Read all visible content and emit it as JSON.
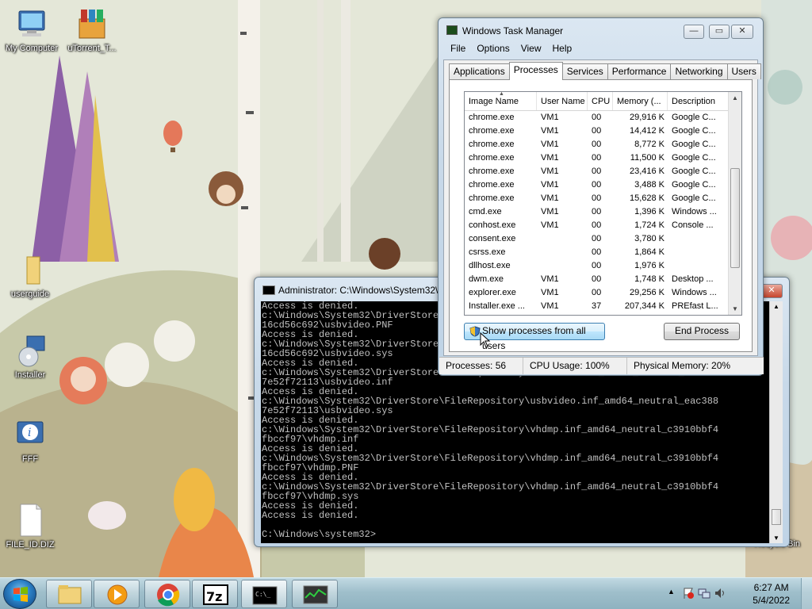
{
  "desktop": {
    "icons": [
      {
        "label": "My Computer"
      },
      {
        "label": "uTorrent_T..."
      },
      {
        "label": "userguide"
      },
      {
        "label": "Installer"
      },
      {
        "label": "FFF"
      },
      {
        "label": "FILE_ID.DIZ"
      },
      {
        "label": "Recycle Bin"
      }
    ]
  },
  "taskmgr": {
    "title": "Windows Task Manager",
    "menu": [
      "File",
      "Options",
      "View",
      "Help"
    ],
    "tabs": [
      "Applications",
      "Processes",
      "Services",
      "Performance",
      "Networking",
      "Users"
    ],
    "active_tab": "Processes",
    "columns": [
      "Image Name",
      "User Name",
      "CPU",
      "Memory (...",
      "Description"
    ],
    "rows": [
      {
        "name": "chrome.exe",
        "user": "VM1",
        "cpu": "00",
        "mem": "29,916 K",
        "desc": "Google C..."
      },
      {
        "name": "chrome.exe",
        "user": "VM1",
        "cpu": "00",
        "mem": "14,412 K",
        "desc": "Google C..."
      },
      {
        "name": "chrome.exe",
        "user": "VM1",
        "cpu": "00",
        "mem": "8,772 K",
        "desc": "Google C..."
      },
      {
        "name": "chrome.exe",
        "user": "VM1",
        "cpu": "00",
        "mem": "11,500 K",
        "desc": "Google C..."
      },
      {
        "name": "chrome.exe",
        "user": "VM1",
        "cpu": "00",
        "mem": "23,416 K",
        "desc": "Google C..."
      },
      {
        "name": "chrome.exe",
        "user": "VM1",
        "cpu": "00",
        "mem": "3,488 K",
        "desc": "Google C..."
      },
      {
        "name": "chrome.exe",
        "user": "VM1",
        "cpu": "00",
        "mem": "15,628 K",
        "desc": "Google C..."
      },
      {
        "name": "cmd.exe",
        "user": "VM1",
        "cpu": "00",
        "mem": "1,396 K",
        "desc": "Windows ..."
      },
      {
        "name": "conhost.exe",
        "user": "VM1",
        "cpu": "00",
        "mem": "1,724 K",
        "desc": "Console ..."
      },
      {
        "name": "consent.exe",
        "user": "",
        "cpu": "00",
        "mem": "3,780 K",
        "desc": ""
      },
      {
        "name": "csrss.exe",
        "user": "",
        "cpu": "00",
        "mem": "1,864 K",
        "desc": ""
      },
      {
        "name": "dllhost.exe",
        "user": "",
        "cpu": "00",
        "mem": "1,976 K",
        "desc": ""
      },
      {
        "name": "dwm.exe",
        "user": "VM1",
        "cpu": "00",
        "mem": "1,748 K",
        "desc": "Desktop ..."
      },
      {
        "name": "explorer.exe",
        "user": "VM1",
        "cpu": "00",
        "mem": "29,256 K",
        "desc": "Windows ..."
      },
      {
        "name": "Installer.exe ...",
        "user": "VM1",
        "cpu": "37",
        "mem": "207,344 K",
        "desc": "PREfast L..."
      }
    ],
    "show_all_label": "Show processes from all users",
    "end_process_label": "End Process",
    "status": {
      "processes": "Processes: 56",
      "cpu": "CPU Usage: 100%",
      "memory": "Physical Memory: 20%"
    }
  },
  "cmd": {
    "title": "Administrator: C:\\Windows\\System32\\cmd.exe",
    "lines": [
      "Access is denied.",
      "c:\\Windows\\System32\\DriverStore\\FileRepository\\usbvideo.inf_amd64_neutral_eac3887",
      "16cd56c692\\usbvideo.PNF",
      "Access is denied.",
      "c:\\Windows\\System32\\DriverStore\\FileRepository\\usbvideo.inf_amd64_neutral_eac3887",
      "16cd56c692\\usbvideo.sys",
      "Access is denied.",
      "c:\\Windows\\System32\\DriverStore\\FileRepository\\usbvideo.inf_amd64_neutral_eac3888",
      "7e52f72113\\usbvideo.inf",
      "Access is denied.",
      "c:\\Windows\\System32\\DriverStore\\FileRepository\\usbvideo.inf_amd64_neutral_eac388",
      "7e52f72113\\usbvideo.sys",
      "Access is denied.",
      "c:\\Windows\\System32\\DriverStore\\FileRepository\\vhdmp.inf_amd64_neutral_c3910bbf4",
      "fbccf97\\vhdmp.inf",
      "Access is denied.",
      "c:\\Windows\\System32\\DriverStore\\FileRepository\\vhdmp.inf_amd64_neutral_c3910bbf4",
      "fbccf97\\vhdmp.PNF",
      "Access is denied.",
      "c:\\Windows\\System32\\DriverStore\\FileRepository\\vhdmp.inf_amd64_neutral_c3910bbf4",
      "fbccf97\\vhdmp.sys",
      "Access is denied.",
      "Access is denied.",
      "",
      "C:\\Windows\\system32>"
    ]
  },
  "taskbar": {
    "apps": [
      "Windows Explorer",
      "Windows Media Player",
      "Google Chrome",
      "7-Zip",
      "Command Prompt",
      "Task Manager"
    ],
    "time": "6:27 AM",
    "date": "5/4/2022"
  },
  "colors": {
    "console_bg": "#000000",
    "console_fg": "#c0c0c0",
    "taskbar": "#9fbfcb",
    "window_frame": "#c8d9e9"
  }
}
